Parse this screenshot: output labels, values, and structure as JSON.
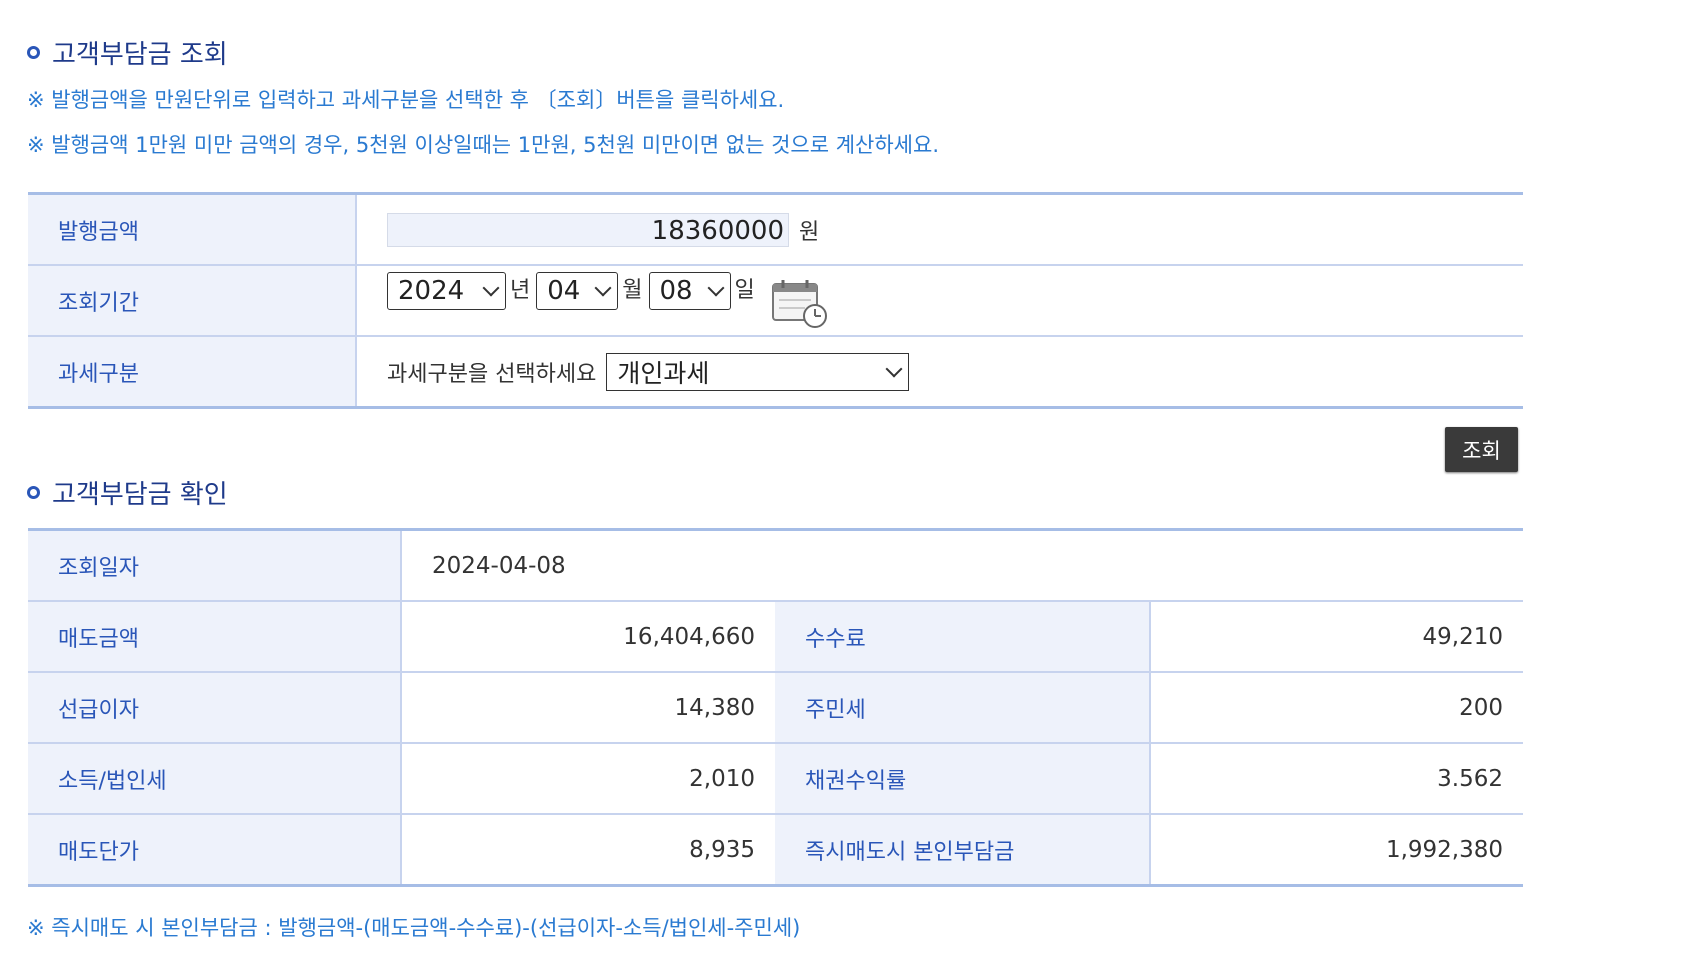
{
  "section1": {
    "title": "고객부담금 조회",
    "note1": "※ 발행금액을 만원단위로 입력하고 과세구분을 선택한 후 〔조회〕버튼을 클릭하세요.",
    "note2": "※ 발행금액 1만원 미만 금액의 경우, 5천원 이상일때는 1만원, 5천원 미만이면 없는 것으로 계산하세요."
  },
  "form": {
    "amount_label": "발행금액",
    "amount_value": "18360000",
    "amount_unit": "원",
    "period_label": "조회기간",
    "year": "2024",
    "year_unit": "년",
    "month": "04",
    "month_unit": "월",
    "day": "08",
    "day_unit": "일",
    "tax_label": "과세구분",
    "tax_prompt": "과세구분을 선택하세요",
    "tax_value": "개인과세",
    "calendar_icon": "calendar-clock-icon"
  },
  "search_button": "조회",
  "section2": {
    "title": "고객부담금 확인"
  },
  "result": {
    "date_label": "조회일자",
    "date_value": "2024-04-08",
    "rows": [
      {
        "l1": "매도금액",
        "v1": "16,404,660",
        "l2": "수수료",
        "v2": "49,210"
      },
      {
        "l1": "선급이자",
        "v1": "14,380",
        "l2": "주민세",
        "v2": "200"
      },
      {
        "l1": "소득/법인세",
        "v1": "2,010",
        "l2": "채권수익률",
        "v2": "3.562"
      },
      {
        "l1": "매도단가",
        "v1": "8,935",
        "l2": "즉시매도시 본인부담금",
        "v2": "1,992,380"
      }
    ]
  },
  "footer_note": "※ 즉시매도 시 본인부담금 : 발행금액-(매도금액-수수료)-(선급이자-소득/법인세-주민세)",
  "colors": {
    "accent": "#2a56b8",
    "note": "#2a7ad1",
    "label_bg": "#eef2fb",
    "border": "#a6bde6",
    "button_bg": "#3a3a3a"
  }
}
